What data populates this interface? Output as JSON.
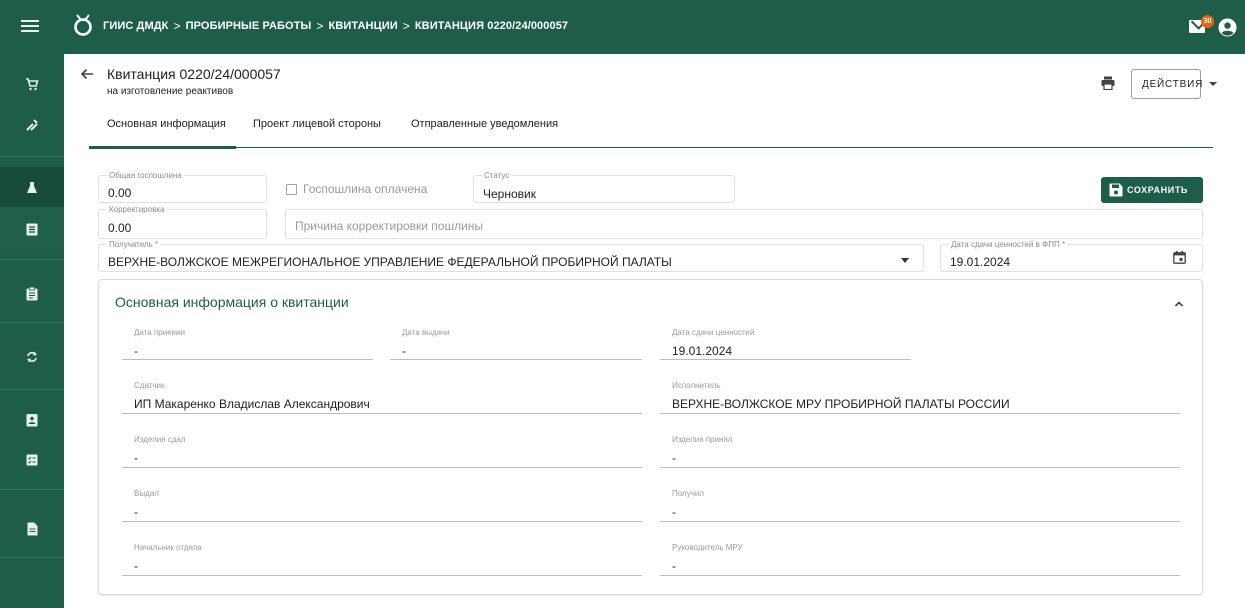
{
  "topbar": {
    "breadcrumb": [
      "ГИИС ДМДК",
      "ПРОБИРНЫЕ РАБОТЫ",
      "КВИТАНЦИИ",
      "КВИТАНЦИЯ 0220/24/000057"
    ],
    "separator": ">",
    "notifications_count": "30"
  },
  "header": {
    "title": "Квитанция 0220/24/000057",
    "subtitle": "на изготовление реактивов",
    "actions_label": "ДЕЙСТВИЯ"
  },
  "tabs": [
    {
      "label": "Основная информация",
      "active": true
    },
    {
      "label": "Проект лицевой стороны",
      "active": false
    },
    {
      "label": "Отправленные уведомления",
      "active": false
    }
  ],
  "form": {
    "total_fee": {
      "label": "Общая госпошлина",
      "value": "0.00"
    },
    "fee_paid": {
      "label": "Госпошлина оплачена",
      "checked": false
    },
    "status": {
      "label": "Статус",
      "value": "Черновик"
    },
    "save_label": "СОХРАНИТЬ",
    "adjustment": {
      "label": "Корректировка",
      "value": "0.00"
    },
    "adjustment_reason": {
      "placeholder": "Причина корректировки пошлины"
    },
    "recipient": {
      "label": "Получатель *",
      "value": "ВЕРХНЕ-ВОЛЖСКОЕ МЕЖРЕГИОНАЛЬНОЕ УПРАВЛЕНИЕ ФЕДЕРАЛЬНОЙ ПРОБИРНОЙ ПАЛАТЫ"
    },
    "submission_date": {
      "label": "Дата сдачи ценностей в ФПП *",
      "value": "19.01.2024"
    }
  },
  "card": {
    "title": "Основная информация о квитанции",
    "fields": {
      "date_received": {
        "label": "Дата приемки",
        "value": "-"
      },
      "date_issued": {
        "label": "Дата выдачи",
        "value": "-"
      },
      "date_submitted": {
        "label": "Дата сдачи ценностей",
        "value": "19.01.2024"
      },
      "submitter": {
        "label": "Сдатчик",
        "value": "ИП Макаренко Владислав Александрович"
      },
      "executor": {
        "label": "Исполнитель",
        "value": "ВЕРХНЕ-ВОЛЖСКОЕ МРУ ПРОБИРНОЙ ПАЛАТЫ РОССИИ"
      },
      "items_handed": {
        "label": "Изделия сдал",
        "value": "-"
      },
      "items_accepted": {
        "label": "Изделия принял",
        "value": "-"
      },
      "issued_by": {
        "label": "Выдал",
        "value": "-"
      },
      "received_by": {
        "label": "Получил",
        "value": "-"
      },
      "dept_head": {
        "label": "Начальник отдела",
        "value": "-"
      },
      "mru_head": {
        "label": "Руководитель МРУ",
        "value": "-"
      }
    }
  },
  "colors": {
    "brand": "#1e5d4a",
    "badge": "#e8640a"
  },
  "icons": {
    "menu": "menu-icon",
    "logo": "ring-logo-icon",
    "mail": "mail-icon",
    "account": "account-icon",
    "back": "arrow-left-icon",
    "print": "printer-icon",
    "save": "floppy-icon",
    "calendar": "calendar-icon",
    "collapse": "chevron-up-icon"
  }
}
